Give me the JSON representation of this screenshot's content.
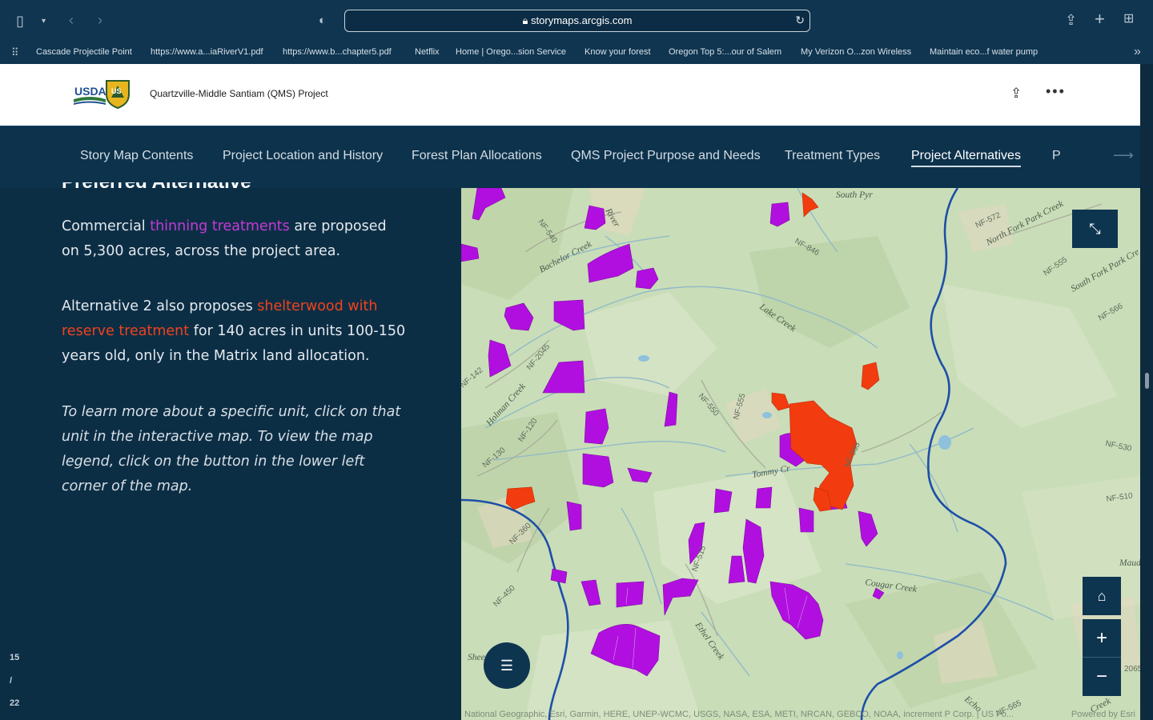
{
  "browser": {
    "url": "storymaps.arcgis.com",
    "bookmarks": [
      "Cascade Projectile Point",
      "https://www.a...iaRiverV1.pdf",
      "https://www.b...chapter5.pdf",
      "Netflix",
      "Home | Orego...sion Service",
      "Know your forest",
      "Oregon Top 5:...our of Salem",
      "My Verizon O...zon Wireless",
      "Maintain eco...f water pump"
    ]
  },
  "header": {
    "usda_text": "USDA",
    "fs_text": "US",
    "title": "Quartzville-Middle Santiam (QMS) Project"
  },
  "nav": {
    "items": [
      "Story Map Contents",
      "Project Location and History",
      "Forest Plan Allocations",
      "QMS Project Purpose and Needs",
      "Treatment Types",
      "Project Alternatives",
      "P"
    ],
    "active": "Project Alternatives"
  },
  "panel": {
    "heading": "Preferred Alternative",
    "p1_a": "Commercial ",
    "p1_link": "thinning treatments",
    "p1_b": " are proposed on 5,300 acres, across the project area.",
    "p2_a": "Alternative 2 also proposes ",
    "p2_link": "shelterwood with reserve treatment",
    "p2_b": " for 140 acres in units 100-150 years old, only in the Matrix land allocation.",
    "p3": "To learn more about a specific unit, click on that unit in the interactive map. To view the map legend, click on the button in the lower left corner of the map.",
    "counter_current": "15",
    "counter_sep": "/",
    "counter_total": "22"
  },
  "map": {
    "labels": [
      "South Pyr",
      "River",
      "NF-540",
      "Bachelor Creek",
      "NF-572",
      "North Fork Park Creek",
      "NF-555",
      "South Fork Park Cre",
      "NF-846",
      "Lake Creek",
      "NF-566",
      "NF-2045",
      "NF-142",
      "Holman Creek",
      "NF-120",
      "NF-130",
      "NF-550",
      "NF-555",
      "Tommy Cr",
      "NF-565",
      "NF-530",
      "NF-510",
      "NF-360",
      "NF-450",
      "NF-515",
      "Cougar Creek",
      "Ethel Creek",
      "Maud",
      "Shee",
      "2065",
      "Echo",
      "NF-565",
      "Creek"
    ],
    "attribution": "National Geographic, Esri, Garmin, HERE, UNEP-WCMC, USGS, NASA, ESA, METI, NRCAN, GEBCO, NOAA, increment P Corp. | US Fo...",
    "powered_by": "Powered by Esri",
    "colors": {
      "thinning": "#b10fe0",
      "shelterwood": "#f23c0f",
      "river": "#1d4fa8",
      "terrain": "#c9ddb8"
    }
  }
}
